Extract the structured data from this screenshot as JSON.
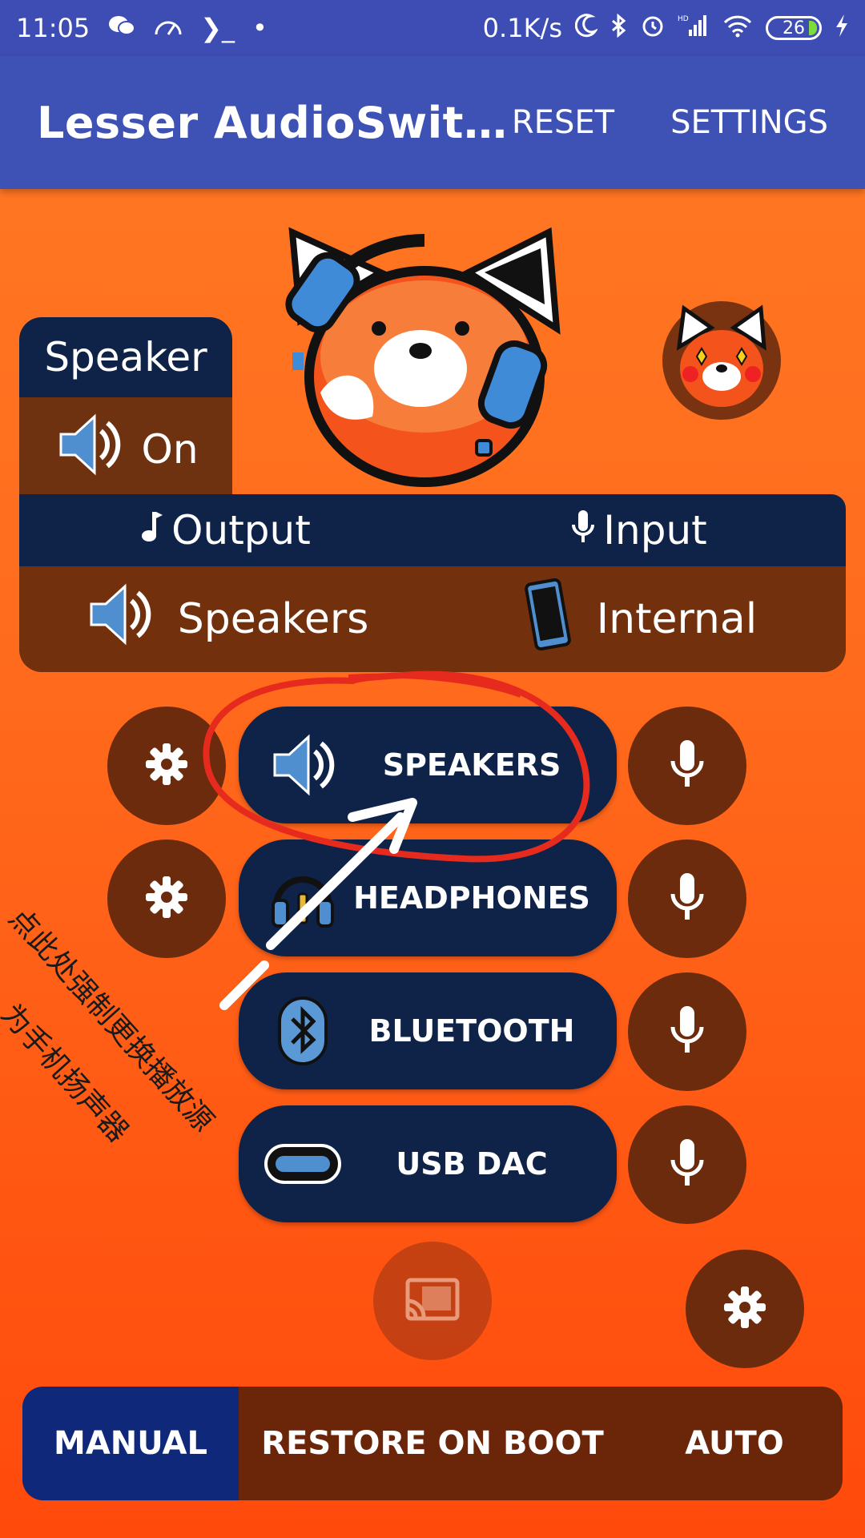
{
  "status_bar": {
    "time": "11:05",
    "prompt": "❯_",
    "dot": "•",
    "net_speed": "0.1K/s",
    "hd": "HD",
    "battery": "26"
  },
  "app_bar": {
    "title": "Lesser AudioSwit…",
    "reset": "RESET",
    "settings": "SETTINGS"
  },
  "status_card": {
    "title": "Speaker",
    "state": "On"
  },
  "io_panel": {
    "output_header": "Output",
    "input_header": "Input",
    "output_value": "Speakers",
    "input_value": "Internal"
  },
  "devices": [
    {
      "label": "SPEAKERS",
      "icon": "speaker-icon"
    },
    {
      "label": "HEADPHONES",
      "icon": "headphones-icon"
    },
    {
      "label": "BLUETOOTH",
      "icon": "bluetooth-icon"
    },
    {
      "label": "USB DAC",
      "icon": "usb-c-icon"
    }
  ],
  "annotation": {
    "line1": "点此处强制更换播放源",
    "line2": "为手机扬声器"
  },
  "modes": {
    "manual": "MANUAL",
    "restore": "RESTORE ON BOOT",
    "auto": "AUTO"
  },
  "colors": {
    "app_bar": "#3e51b5",
    "background": "#ff6a1c",
    "navy": "#0f2348",
    "brown": "#6f3210",
    "manual_active": "#10287a",
    "annotation_red": "#e62b1e"
  }
}
